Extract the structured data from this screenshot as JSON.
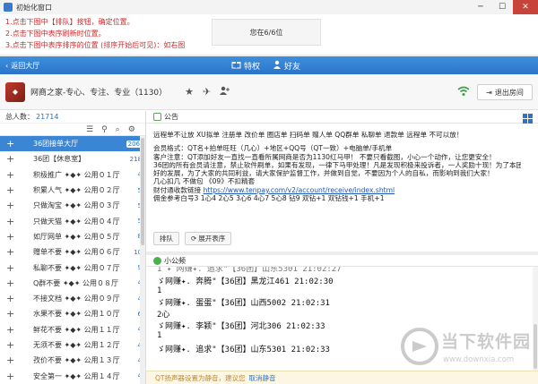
{
  "window": {
    "title": "初始化窗口"
  },
  "instructions": [
    "1.点击下图中【排队】按钮，确定位置。",
    "2.点击下图中表序刷新时位置。",
    "3.点击下图中表序排序的位置 (排序开始后可见)：如右图"
  ],
  "queue_status": "您在6/6位",
  "navbar": {
    "back_label": "返回大厅",
    "privilege_label": "特权",
    "friends_label": "好友"
  },
  "room": {
    "name": "网商之家-专心、专注、专业（1130）",
    "exit_label": "退出房间"
  },
  "members": {
    "total_label": "总人数：",
    "total_value": "21714",
    "rows": [
      {
        "name": "36团接单大厅",
        "count": "206",
        "selected": true
      },
      {
        "name": "36团【休息室】",
        "count": "218",
        "selected": false
      },
      {
        "name": "积极推广 ✦◆✦ 公用０１厅",
        "count": "4",
        "selected": false
      },
      {
        "name": "积累人气 ✦◆✦ 公用０２厅",
        "count": "5",
        "selected": false
      },
      {
        "name": "只做淘宝 ✦◆✦ 公用０３厅",
        "count": "5",
        "selected": false
      },
      {
        "name": "只做天猫 ✦◆✦ 公用０４厅",
        "count": "5",
        "selected": false
      },
      {
        "name": "如厅网单 ✦◆✦ 公用０５厅",
        "count": "8",
        "selected": false
      },
      {
        "name": "赠单不要 ✦◆✦ 公用０６厅",
        "count": "10",
        "selected": false
      },
      {
        "name": "私聊不要 ✦◆✦ 公用０７厅",
        "count": "9",
        "selected": false
      },
      {
        "name": "Q群不要 ✦◆✦ 公用０８厅",
        "count": "4",
        "selected": false
      },
      {
        "name": "不接文档 ✦◆✦ 公用０９厅",
        "count": "4",
        "selected": false
      },
      {
        "name": "水果不要 ✦◆✦ 公用１０厅",
        "count": "6",
        "selected": false
      },
      {
        "name": "鲜花不要 ✦◆✦ 公用１１厅",
        "count": "4",
        "selected": false
      },
      {
        "name": "无须不要 ✦◆✦ 公用１２厅",
        "count": "4",
        "selected": false
      },
      {
        "name": "孜价不要 ✦◆✦ 公用１３厅",
        "count": "4",
        "selected": false
      },
      {
        "name": "安全第一 ✦◆✦ 公用１４厅",
        "count": "4",
        "selected": false
      }
    ]
  },
  "announcement": {
    "tab_label": "公告",
    "lines": [
      "远程单不让放 XU拟单 注册单 改价单 圈店单 扫码单 赠人单 QQ群单 私聊单 退款单 远程单 不可以放！",
      "",
      "会员格式：QT名+拍单旺旺（几心）+地区+QQ号（QT一致）+电脑单/手机单",
      "客户注意：QT添加好友一直找一直看所属网商是否为1130红马甲！ 不要只看截图，小心一个动作，让您更安全！",
      "36团的所有会员请注意，禁止软件刷单，如果有发现，一律下马甲处理！凡是发现积极来投诉者，一人奖励十现！为了本团长久更",
      "好的发展，为了大家的共同利益，请大家保护监督工作，并做到自觉，不要因为个人的自私，而影响到我们大家！",
      "几心扣几 不做包 《09》不扣精套"
    ],
    "link_prefix": "财付通收款链接 ",
    "link_text": "https://www.tenpay.com/v2/account/receive/index.shtml",
    "bottom_line": "佣金参考白号3 1心4 2心5 3心6 4心7 5心8 钻9 双钻+1 双钻钱+1 手机+1",
    "buttons": {
      "queue": "排队",
      "expand": "展开表序"
    }
  },
  "chat": {
    "tab_label": "小公频",
    "partial": "1  ✦ 网赚✦. 追求\"【36团】山东5301 21:02:27",
    "messages": [
      {
        "index": "",
        "text": "ゞ网赚✦. 奔腾\"【36团】黑龙江461 21:02:30"
      },
      {
        "index": "1",
        "text": "ゞ网赚✦. 蛋蛋\"【36团】山西5002 21:02:31"
      },
      {
        "index": "2心",
        "text": "ゞ网赚✦. 李颖\"【36团】河北306 21:02:33"
      },
      {
        "index": "1",
        "text": "ゞ网赚✦. 追求\"【36团】山东5301 21:02:33"
      }
    ],
    "bottom_notice": "QT扬声器设置为静音，建议您",
    "bottom_link": "取消静音"
  },
  "watermark": {
    "title": "当下软件园",
    "url": "www.downxia.com"
  },
  "colors": {
    "accent": "#2a74c9",
    "instruction_red": "#d12a2a",
    "selected_row": "#3a86d4"
  }
}
